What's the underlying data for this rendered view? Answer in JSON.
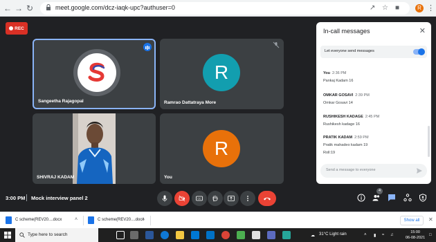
{
  "browser": {
    "url": "meet.google.com/dcz-iaqk-upc?authuser=0",
    "profile_initial": "R"
  },
  "meet": {
    "rec_label": "REC",
    "time": "3:00 PM",
    "meeting_name": "Mock interview panel 2",
    "participants": [
      {
        "name": "Sangeetha Rajagopal",
        "avatar": "S",
        "speaking": true
      },
      {
        "name": "Ramrao Dattatraya More",
        "avatar": "R",
        "avatar_color": "#129eaf",
        "muted": true
      },
      {
        "name": "SHIVRAJ KADAM",
        "video": true
      },
      {
        "name": "You",
        "avatar": "R",
        "avatar_color": "#e8710a"
      }
    ],
    "people_count": "4"
  },
  "chat": {
    "title": "In-call messages",
    "allow_label": "Let everyone send messages",
    "allow_enabled": true,
    "messages": [
      {
        "sender": "You",
        "time": "2:36 PM",
        "text": "Pankaj Kadam  16"
      },
      {
        "sender": "OMKAR GOSAVI",
        "time": "2:39 PM",
        "text": "Omkar Gosavi 14"
      },
      {
        "sender": "RUSHIKESH KADAGE",
        "time": "2:45 PM",
        "text": "Rushikesh kadage 16"
      },
      {
        "sender": "PRATIK KADAM",
        "time": "2:59 PM",
        "text": "Pratik mahadeo kadam 19",
        "text2": "Roll:19"
      }
    ],
    "input_placeholder": "Send a message to everyone"
  },
  "downloads": {
    "items": [
      {
        "name": "C scheme(REV20....docx"
      },
      {
        "name": "C scheme(REV20....docx"
      }
    ],
    "show_all": "Show all"
  },
  "taskbar": {
    "search_placeholder": "Type here to search",
    "weather": "31°C  Light rain",
    "time": "15:00",
    "date": "06-08-2021"
  },
  "colors": {
    "meet_bg": "#202124",
    "tile_bg": "#3c4043",
    "accent": "#1a73e8",
    "leave": "#ea4335"
  }
}
